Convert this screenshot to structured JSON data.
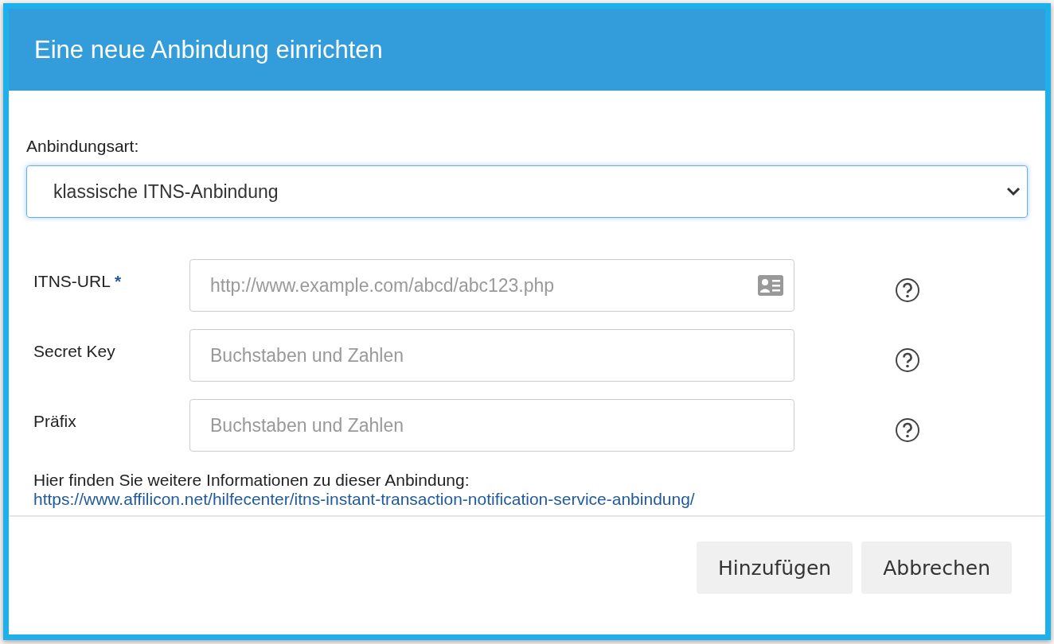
{
  "dialog": {
    "title": "Eine neue Anbindung einrichten",
    "connection_type": {
      "label": "Anbindungsart:",
      "value": "klassische ITNS-Anbindung"
    },
    "fields": [
      {
        "label": "ITNS-URL",
        "required": true,
        "required_mark": "*",
        "placeholder": "http://www.example.com/abcd/abc123.php",
        "contact_icon": true
      },
      {
        "label": "Secret Key",
        "placeholder": "Buchstaben und Zahlen"
      },
      {
        "label": "Präfix",
        "placeholder": "Buchstaben und Zahlen"
      }
    ],
    "help_text": "Hier finden Sie weitere Informationen zu dieser Anbindung:",
    "help_link": "https://www.affilicon.net/hilfecenter/itns-instant-transaction-notification-service-anbindung/",
    "buttons": [
      "Hinzufügen",
      "Abbrechen"
    ]
  }
}
